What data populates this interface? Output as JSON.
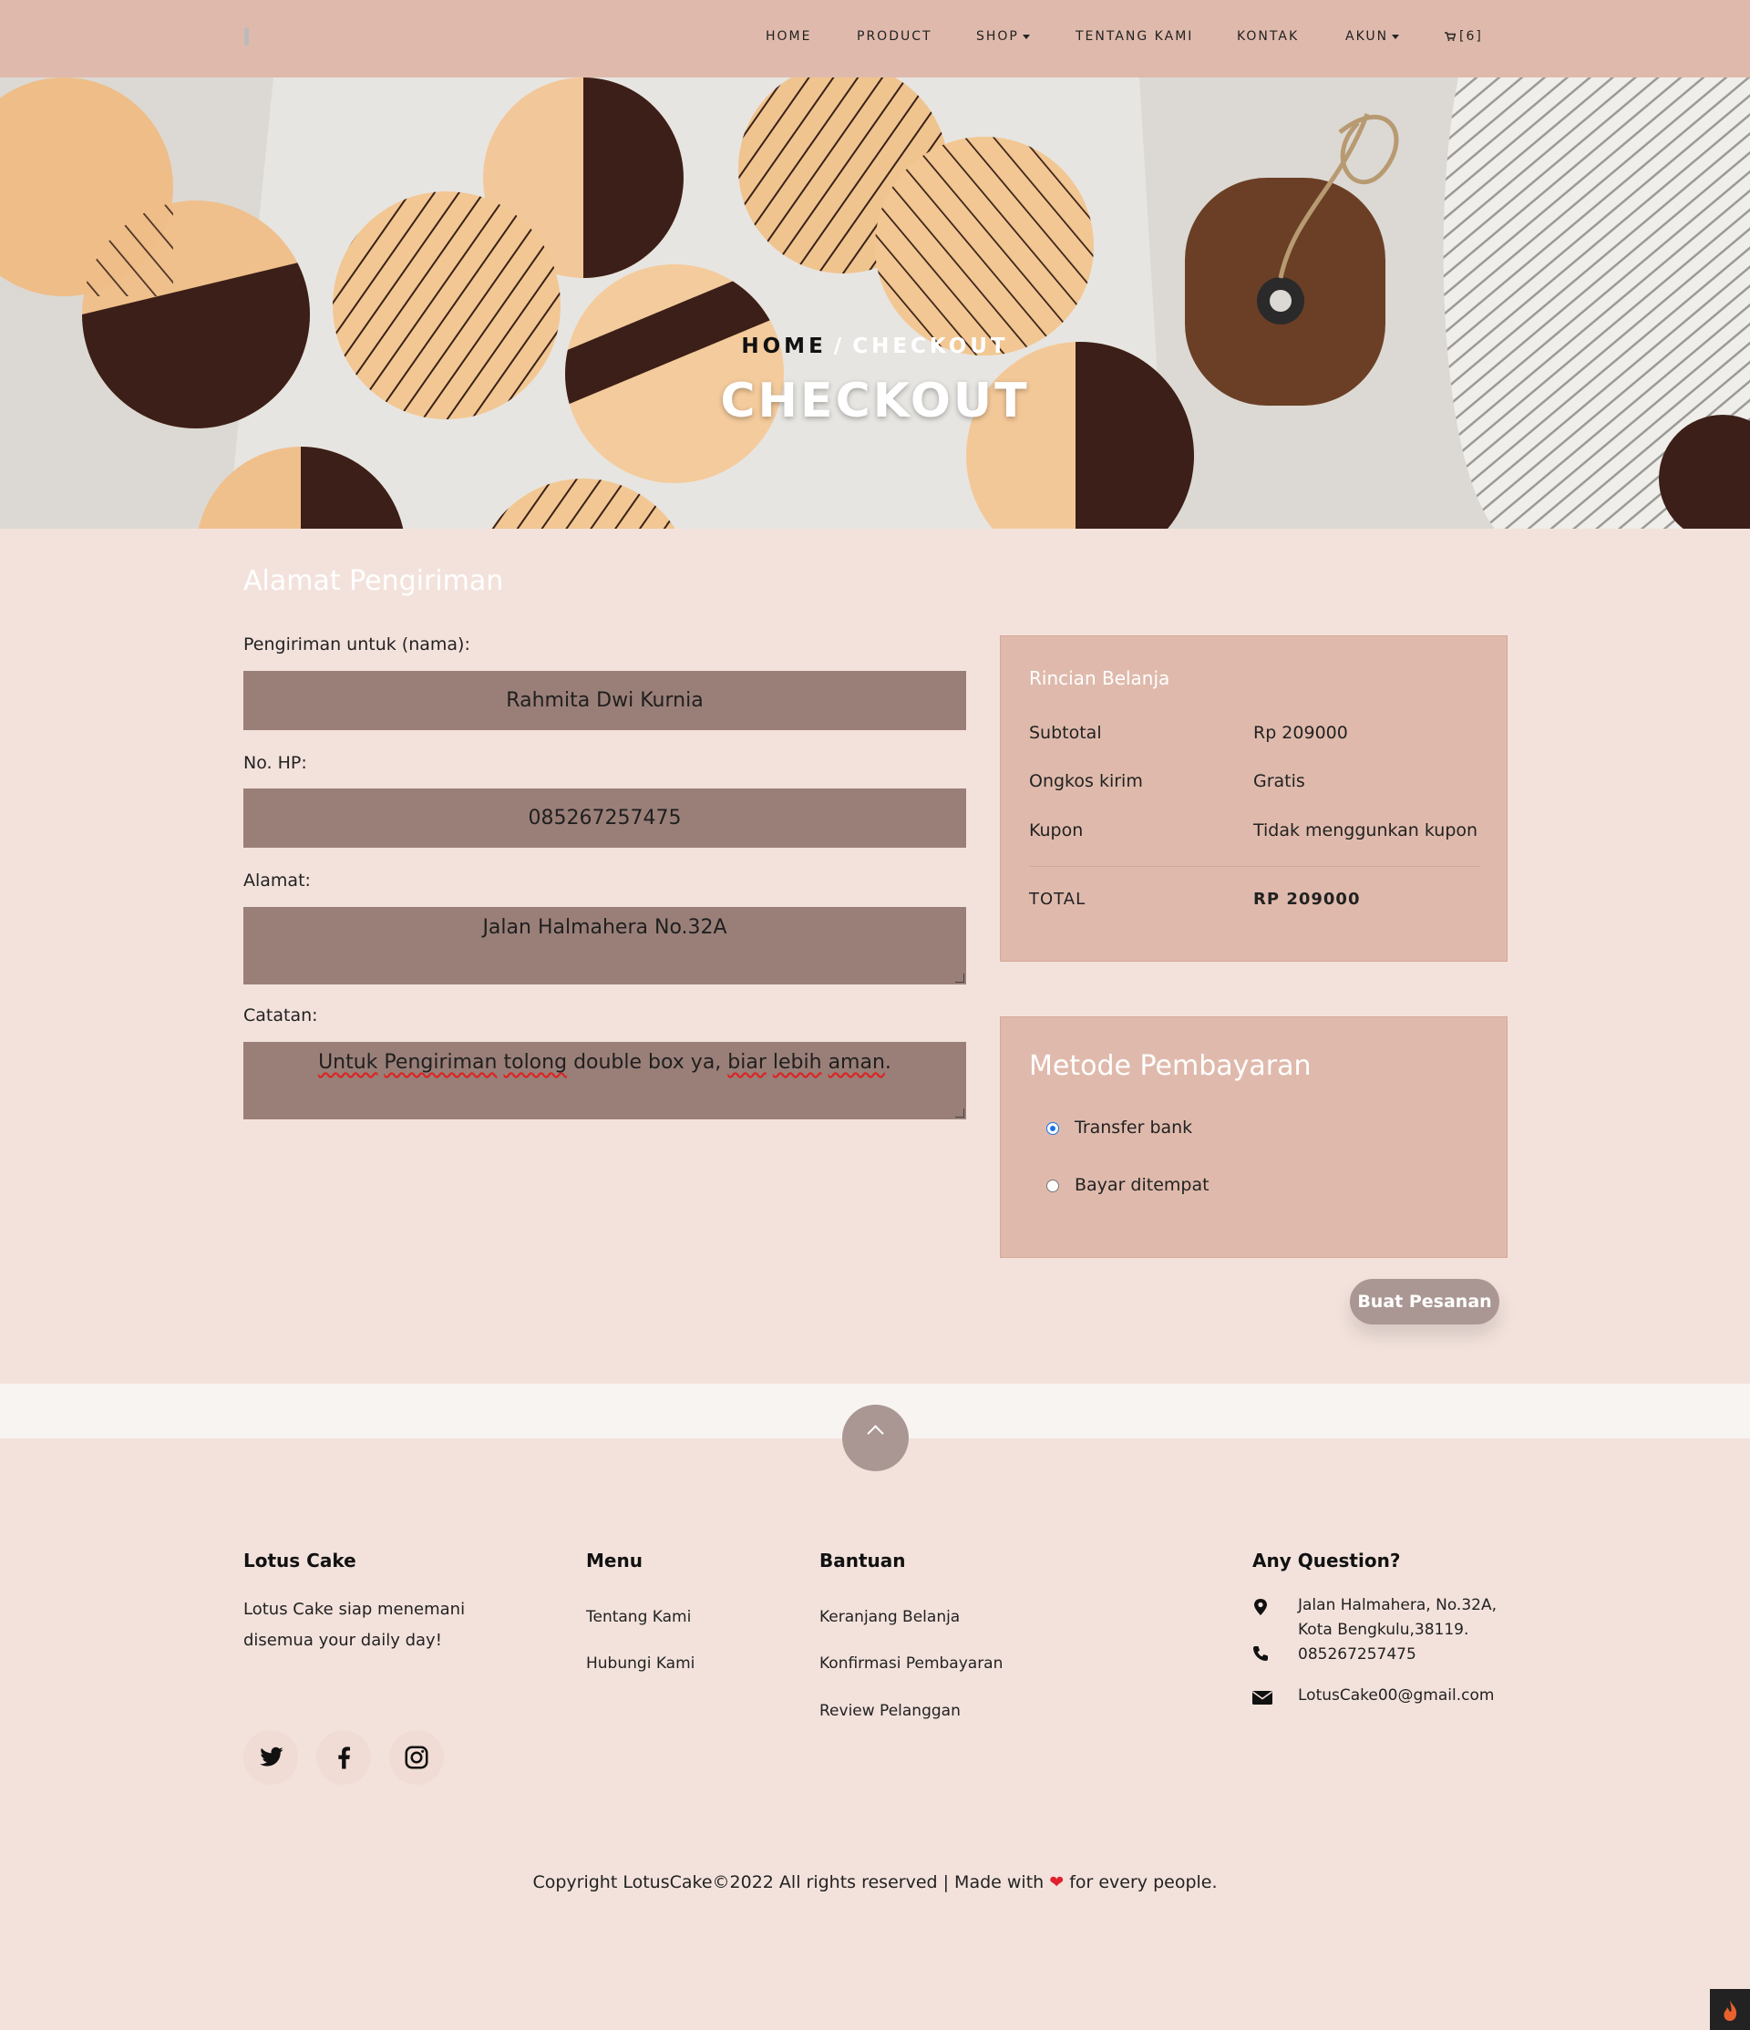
{
  "nav": {
    "items": [
      "HOME",
      "PRODUCT",
      "SHOP",
      "TENTANG KAMI",
      "KONTAK",
      "AKUN"
    ],
    "cart_label": "[6]"
  },
  "hero": {
    "crumb_home": "HOME",
    "crumb_separator": "/",
    "crumb_current": "CHECKOUT",
    "title": "CHECKOUT"
  },
  "shipping": {
    "title": "Alamat Pengiriman",
    "name_label": "Pengiriman untuk (nama):",
    "name_value": "Rahmita Dwi Kurnia",
    "phone_label": "No. HP:",
    "phone_value": "085267257475",
    "address_label": "Alamat:",
    "address_value": "Jalan Halmahera No.32A",
    "notes_label": "Catatan:",
    "notes_words": [
      "Untuk",
      "Pengiriman",
      "tolong",
      "double box ya,",
      "biar",
      "lebih",
      "aman",
      "."
    ]
  },
  "summary": {
    "title": "Rincian Belanja",
    "rows": [
      {
        "label": "Subtotal",
        "value": "Rp 209000"
      },
      {
        "label": "Ongkos kirim",
        "value": "Gratis"
      },
      {
        "label": "Kupon",
        "value": "Tidak menggunkan kupon"
      }
    ],
    "total_label": "TOTAL",
    "total_value": "RP 209000"
  },
  "payment": {
    "title": "Metode Pembayaran",
    "options": [
      {
        "label": "Transfer bank",
        "selected": true
      },
      {
        "label": "Bayar ditempat",
        "selected": false
      }
    ],
    "order_button": "Buat Pesanan"
  },
  "footer": {
    "brand": {
      "title": "Lotus Cake",
      "text_line1": "Lotus Cake siap menemani",
      "text_line2": "disemua your daily day!"
    },
    "menu": {
      "title": "Menu",
      "links": [
        "Tentang Kami",
        "Hubungi Kami"
      ]
    },
    "help": {
      "title": "Bantuan",
      "links": [
        "Keranjang Belanja",
        "Konfirmasi Pembayaran",
        "Review Pelanggan"
      ]
    },
    "contact": {
      "title": "Any Question?",
      "address_line1": "Jalan Halmahera, No.32A,",
      "address_line2": "Kota Bengkulu,38119.",
      "phone": "085267257475",
      "email": "LotusCake00@gmail.com"
    },
    "social": [
      "twitter-icon",
      "facebook-icon",
      "instagram-icon"
    ],
    "copyright_pre": "Copyright LotusCake©2022 All rights reserved | Made with",
    "copyright_post": "for every people."
  },
  "colors": {
    "nav_bg": "#dfbaac",
    "page_bg": "#f3e2dc",
    "field_bg": "#9a7f78",
    "panel_bg": "#dfbaac",
    "button_bg": "#aa9793",
    "heart": "#e0202e"
  }
}
